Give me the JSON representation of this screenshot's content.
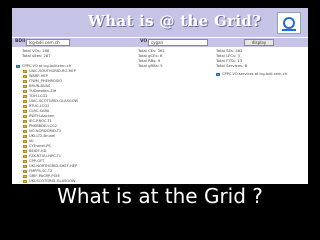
{
  "banner": {
    "title": "What is @ the Grid?"
  },
  "toolbar": {
    "boii_label": "BDII",
    "boii_value": "lcg-bdii.cern.ch",
    "vo_label": "VO",
    "vo_value": "cygan",
    "display_label": "display"
  },
  "stats": {
    "col1": [
      "Total VOs: 168",
      "Total sites: 287"
    ],
    "col2": [
      "Total CEs: 361",
      "Total gCEs: 6",
      "Total RBs: 9",
      "Total gRBs: 5"
    ],
    "col3": [
      "Total SEs: 462",
      "Total LFCs: 3",
      "Total FTSs: 13",
      "Total Services: 6"
    ]
  },
  "tree": {
    "root": "CPPC-VO at lcg-bdii.cern.ch",
    "children": [
      "UAIC-SOUTHGRID-RO-HEP",
      "WARP-HEP",
      "ITWM_PHEHROSIO",
      "BRUN-BUAS",
      "TUDresden-ZIH",
      "TDH-LCG2",
      "UAIC-SCOTGRID-GLASGOW",
      "RTUC-LCG2",
      "CLRC-SARA",
      "RWTH-Aachen",
      "IEC-RROC-T1",
      "PNKBBDE-LCG2",
      "NO-NORDGRID-T2",
      "UKI-LT2-Brunel",
      "IAI",
      "CYFronet-PS",
      "BEIDF-HD",
      "FZK-NTUU-NPC-T1",
      "CPP-GFT",
      "UKI-NORTHGRID-SHEF-HEP",
      "FMPPS-SC-T2",
      "GRIF-PACRP-POIE",
      "UKI-SCOTGRID-GLASGOW"
    ]
  },
  "right_panel": {
    "item": "CPPC-VO services at lcg-bdii.cern.ch"
  },
  "caption": "What is at the Grid ?"
}
